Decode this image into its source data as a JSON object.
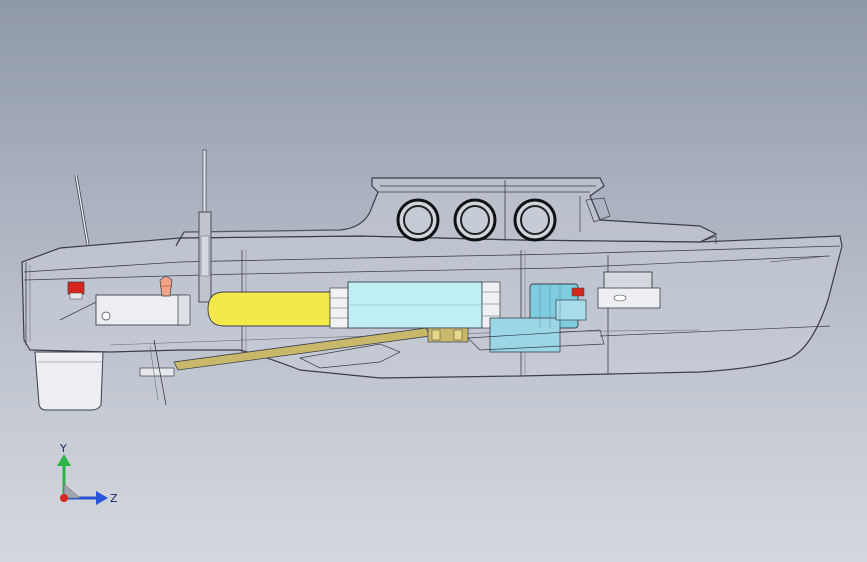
{
  "triad": {
    "y_label": "Y",
    "z_label": "Z"
  },
  "colors": {
    "background_top": "#8f98a8",
    "background_bottom": "#d4d8de",
    "hull_line": "#3a3f4a",
    "battery": "#f5e84a",
    "electronics_box": "#bfeef5",
    "motor": "#7fcbe0",
    "shaft": "#c9b86a",
    "rudder": "#e8eaee",
    "indicator_red": "#d9261c",
    "axis_y": "#2db34a",
    "axis_z": "#2a52d6",
    "axis_origin": "#d9261c"
  },
  "parts": [
    "hull",
    "cabin",
    "portholes",
    "mast",
    "antenna",
    "battery",
    "electronics-box",
    "motor",
    "propeller-shaft",
    "rudder",
    "servo",
    "switch"
  ]
}
